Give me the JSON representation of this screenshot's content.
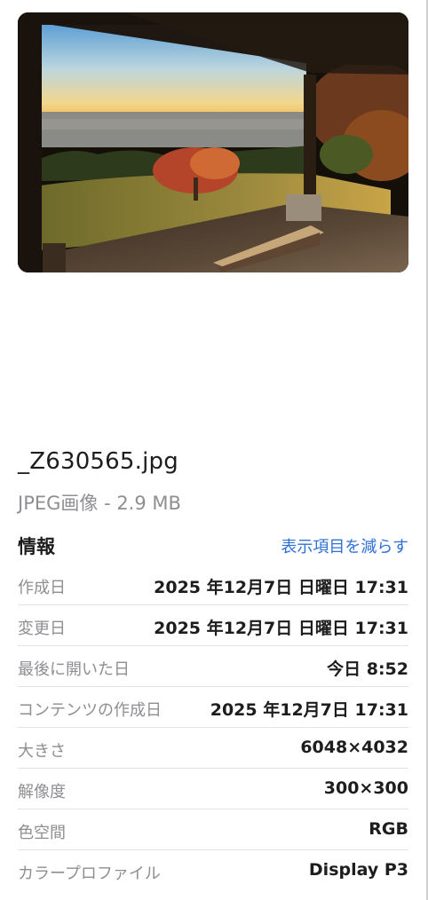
{
  "preview": {
    "alt": "_Z630565.jpg preview"
  },
  "file": {
    "name": "_Z630565.jpg",
    "kind": "JPEG画像 - 2.9 MB"
  },
  "info": {
    "title": "情報",
    "show_less_label": "表示項目を減らす",
    "rows": [
      {
        "label": "作成日",
        "value": "2025 年12月7日 日曜日 17:31"
      },
      {
        "label": "変更日",
        "value": "2025 年12月7日 日曜日 17:31"
      },
      {
        "label": "最後に開いた日",
        "value": "今日 8:52"
      },
      {
        "label": "コンテンツの作成日",
        "value": "2025 年12月7日 17:31"
      },
      {
        "label": "大きさ",
        "value": "6048×4032"
      },
      {
        "label": "解像度",
        "value": "300×300"
      },
      {
        "label": "色空間",
        "value": "RGB"
      },
      {
        "label": "カラープロファイル",
        "value": "Display P3"
      }
    ]
  },
  "colors": {
    "link": "#2f6fd6",
    "secondary_text": "#8e8e93",
    "primary_text": "#1d1d1f"
  }
}
